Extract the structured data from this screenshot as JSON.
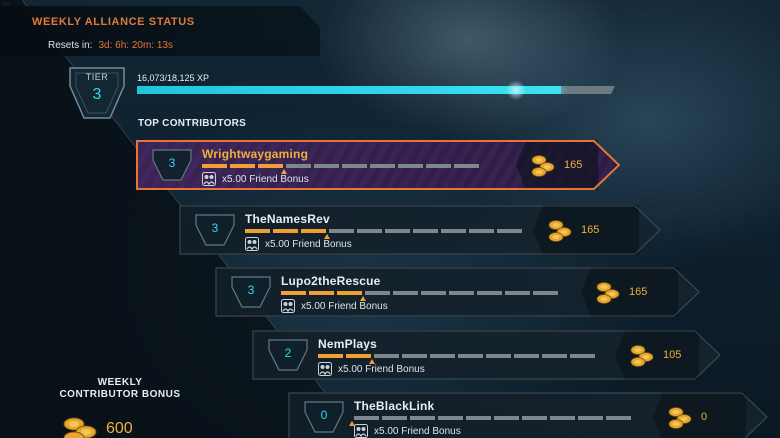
{
  "header": {
    "title": "WEEKLY ALLIANCE STATUS",
    "resets_label": "Resets in:",
    "resets_value": "3d: 6h: 20m: 13s"
  },
  "tier": {
    "label": "TIER",
    "value": "3",
    "xp_text": "16,073/18,125 XP",
    "progress_fraction": 0.8868
  },
  "contributors_heading": "TOP CONTRIBUTORS",
  "contributors": [
    {
      "rank": "3",
      "name": "Wrightwaygaming",
      "bonus": "x5.00 Friend Bonus",
      "coins": "165",
      "segments_filled": 3,
      "segments_total": 10,
      "highlight": true
    },
    {
      "rank": "3",
      "name": "TheNamesRev",
      "bonus": "x5.00 Friend Bonus",
      "coins": "165",
      "segments_filled": 3,
      "segments_total": 10,
      "highlight": false
    },
    {
      "rank": "3",
      "name": "Lupo2theRescue",
      "bonus": "x5.00 Friend Bonus",
      "coins": "165",
      "segments_filled": 3,
      "segments_total": 10,
      "highlight": false
    },
    {
      "rank": "2",
      "name": "NemPlays",
      "bonus": "x5.00 Friend Bonus",
      "coins": "105",
      "segments_filled": 2,
      "segments_total": 10,
      "highlight": false
    },
    {
      "rank": "0",
      "name": "TheBlackLink",
      "bonus": "x5.00 Friend Bonus",
      "coins": "0",
      "segments_filled": 0,
      "segments_total": 10,
      "highlight": false
    }
  ],
  "weekly_bonus": {
    "label_line1": "WEEKLY",
    "label_line2": "CONTRIBUTOR BONUS",
    "value": "600"
  },
  "colors": {
    "accent_orange": "#e8743a",
    "cyan": "#38d6ea",
    "gold": "#f0b03c",
    "segment_on": "#f0a030",
    "segment_off": "#7d878c"
  },
  "icons": {
    "tier": "hexagon-shield-icon",
    "rank": "hexagon-shield-icon",
    "bonus": "friend-bonus-icon",
    "coins": "coin-stack-icon"
  }
}
